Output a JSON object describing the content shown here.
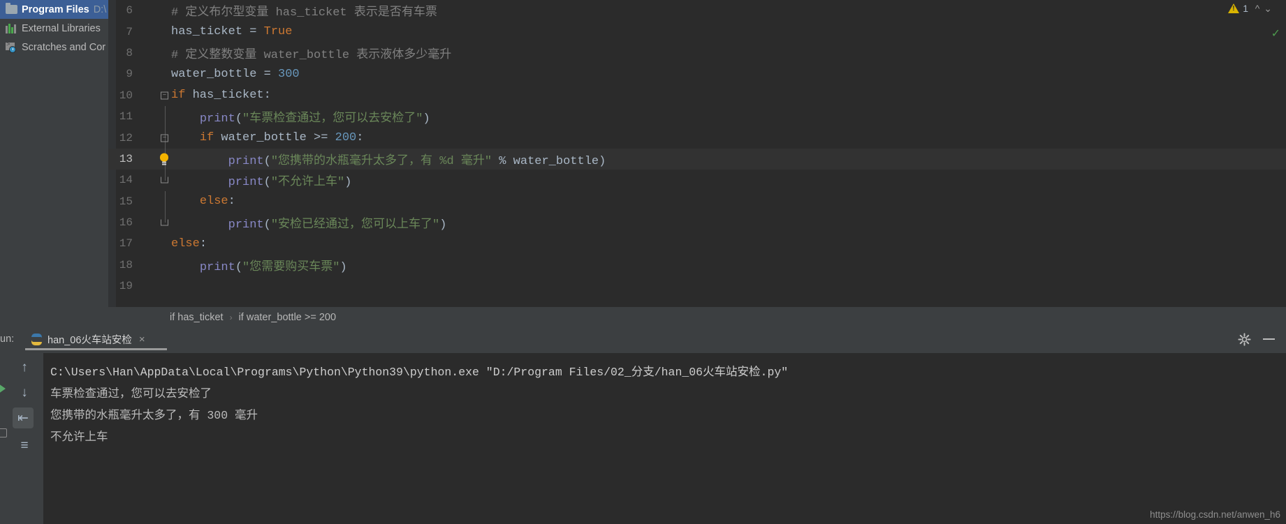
{
  "sidebar": {
    "items": [
      {
        "icon": "folder-icon",
        "label": "Program Files",
        "sub": "D:\\",
        "selected": true
      },
      {
        "icon": "external-libraries-icon",
        "label": "External Libraries",
        "sub": "",
        "selected": false
      },
      {
        "icon": "scratches-icon",
        "label": "Scratches and Cor",
        "sub": "",
        "selected": false
      }
    ]
  },
  "editor": {
    "warning_count": "1",
    "warning_icon": "warning-triangle-icon",
    "chevron_up_icon": "chevron-up-icon",
    "chevron_down_icon": "chevron-down-icon",
    "lines": [
      {
        "no": "6",
        "marker": "none",
        "current": false
      },
      {
        "no": "7",
        "marker": "none",
        "current": false
      },
      {
        "no": "8",
        "marker": "none",
        "current": false
      },
      {
        "no": "9",
        "marker": "none",
        "current": false
      },
      {
        "no": "10",
        "marker": "fold-open",
        "current": false
      },
      {
        "no": "11",
        "marker": "none",
        "current": false
      },
      {
        "no": "12",
        "marker": "fold-open",
        "current": false
      },
      {
        "no": "13",
        "marker": "bulb",
        "current": true
      },
      {
        "no": "14",
        "marker": "fold-end",
        "current": false
      },
      {
        "no": "15",
        "marker": "none",
        "current": false
      },
      {
        "no": "16",
        "marker": "fold-end",
        "current": false
      },
      {
        "no": "17",
        "marker": "none",
        "current": false
      },
      {
        "no": "18",
        "marker": "none",
        "current": false
      },
      {
        "no": "19",
        "marker": "none",
        "current": false
      }
    ],
    "code": {
      "l6": "# 定义布尔型变量 has_ticket 表示是否有车票",
      "l7_name": "has_ticket",
      "l7_eq": " = ",
      "l7_val": "True",
      "l8": "# 定义整数变量 water_bottle 表示液体多少毫升",
      "l9_name": "water_bottle",
      "l9_eq": " = ",
      "l9_val": "300",
      "l10_kw": "if",
      "l10_rest": " has_ticket:",
      "l11_fn": "print",
      "l11_str": "\"车票检查通过，您可以去安检了\"",
      "l12_kw": "if",
      "l12_var": " water_bottle >= ",
      "l12_num": "200",
      "l12_colon": ":",
      "l13_fn": "print",
      "l13_str": "\"您携带的水瓶毫升太多了，有 %d 毫升\"",
      "l13_op": " % ",
      "l13_var": "water_bottle",
      "l14_fn": "print",
      "l14_str": "\"不允许上车\"",
      "l15_kw": "else",
      "l15_colon": ":",
      "l16_fn": "print",
      "l16_str": "\"安检已经通过，您可以上车了\"",
      "l17_kw": "else",
      "l17_colon": ":",
      "l18_fn": "print",
      "l18_str": "\"您需要购买车票\"",
      "l19": ""
    }
  },
  "breadcrumb": {
    "items": [
      "if has_ticket",
      "if water_bottle >= 200"
    ],
    "separator": "›"
  },
  "run_window": {
    "label": "un:",
    "tab": {
      "icon": "python-file-icon",
      "title": "han_06火车站安检",
      "close_icon": "close-icon"
    },
    "gear_icon": "gear-icon",
    "minimize_icon": "minimize-icon",
    "toolbar": {
      "run_icon": "run-icon",
      "scroll_up_icon": "arrow-up-icon",
      "scroll_down_icon": "arrow-down-icon",
      "soft_wrap_icon": "soft-wrap-icon",
      "print_icon": "print-icon",
      "stop_icon": "stop-icon"
    },
    "console": [
      "C:\\Users\\Han\\AppData\\Local\\Programs\\Python\\Python39\\python.exe \"D:/Program Files/02_分支/han_06火车站安检.py\"",
      "车票检查通过，您可以去安检了",
      "您携带的水瓶毫升太多了，有 300 毫升",
      "不允许上车"
    ]
  },
  "watermark": "https://blog.csdn.net/anwen_h6",
  "colors": {
    "bg_editor": "#2b2b2b",
    "bg_panel": "#3c3f41",
    "accent_selection": "#3c5f96",
    "keyword": "#cc7832",
    "string": "#6a8759",
    "number": "#6897bb",
    "function": "#8888c6",
    "comment": "#808080",
    "warning": "#d9b400"
  }
}
